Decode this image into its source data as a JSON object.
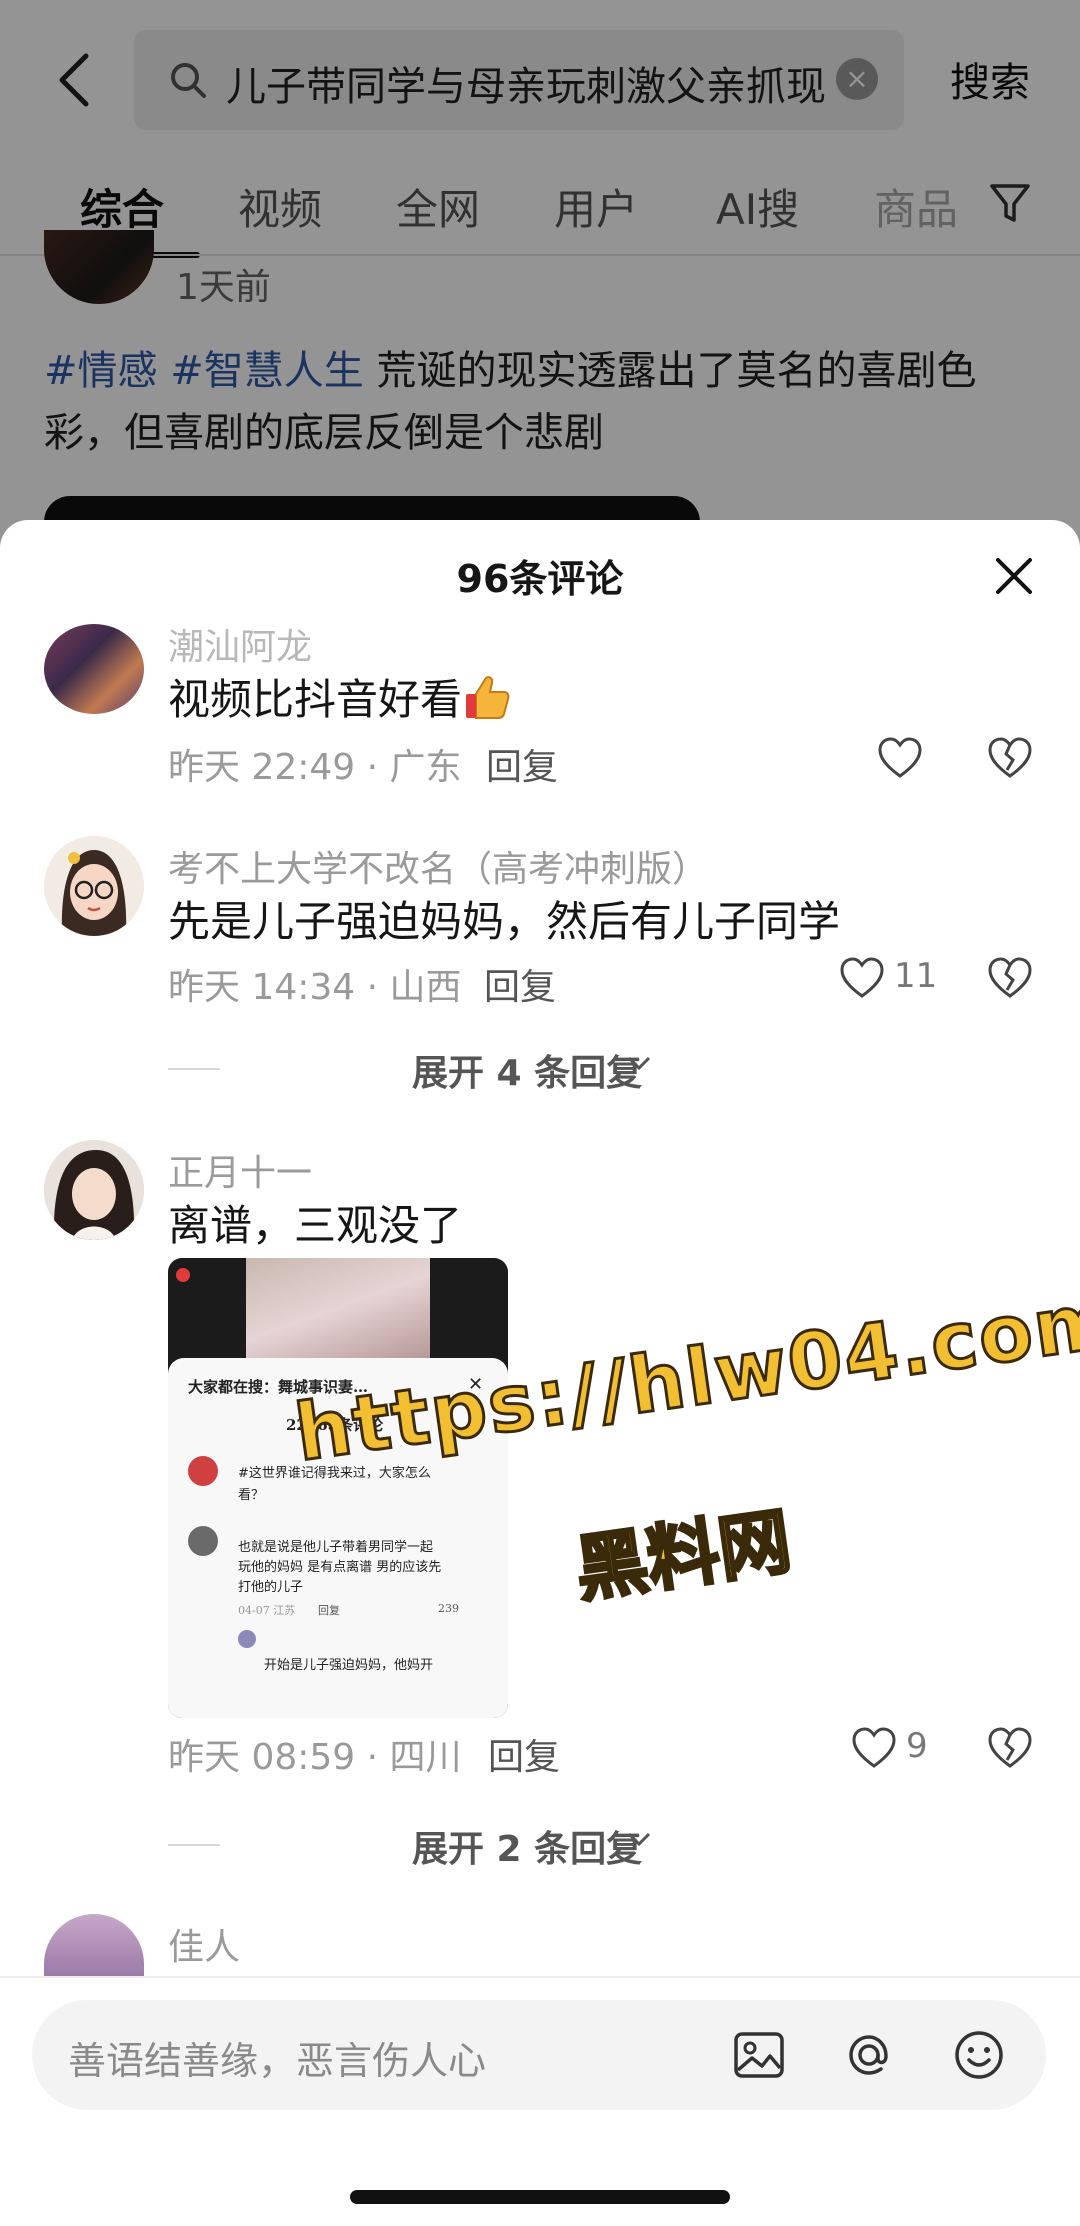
{
  "search": {
    "query": "儿子带同学与母亲玩刺激父亲抓现",
    "clear_icon": "clear-icon",
    "search_button": "搜索"
  },
  "tabs": [
    "综合",
    "视频",
    "全网",
    "用户",
    "AI搜",
    "商品"
  ],
  "post": {
    "time": "1天前",
    "tags": [
      "#情感",
      "#智慧人生"
    ],
    "text_line1_rest": "荒诞的现实透露出了莫名的喜剧色",
    "text_line2": "彩，但喜剧的底层反倒是个悲剧"
  },
  "sheet": {
    "title": "96条评论"
  },
  "comments": [
    {
      "name": "潮汕阿龙",
      "text": "视频比抖音好看",
      "meta": "昨天 22:49 · 广东",
      "reply": "回复",
      "likes": ""
    },
    {
      "name": "考不上大学不改名（高考冲刺版）",
      "text": "先是儿子强迫妈妈，然后有儿子同学",
      "meta": "昨天 14:34 · 山西",
      "reply": "回复",
      "likes": "11",
      "expand": "展开 4 条回复"
    },
    {
      "name": "正月十一",
      "text": "离谱，三观没了",
      "meta": "昨天 08:59 · 四川",
      "reply": "回复",
      "likes": "9",
      "expand": "展开 2 条回复",
      "image": {
        "header": "大家都在搜：舞城事识妻…",
        "count": "22663条评论",
        "line_a": "#这世界谁记得我来过，大家怎么",
        "line_b": "看？",
        "line_c": "也就是说是他儿子带着男同学一起",
        "line_d": "玩他的妈妈 是有点离谱 男的应该先",
        "line_e": "打他的儿子",
        "meta": "04-07 江苏",
        "reply": "回复",
        "likes": "239",
        "line_f": "开始是儿子强迫妈妈，他妈开"
      }
    },
    {
      "name": "佳人"
    }
  ],
  "watermark": {
    "line1": "https://hlw04.com",
    "line2": "黑料网"
  },
  "input": {
    "placeholder": "善语结善缘，恶言伤人心"
  }
}
